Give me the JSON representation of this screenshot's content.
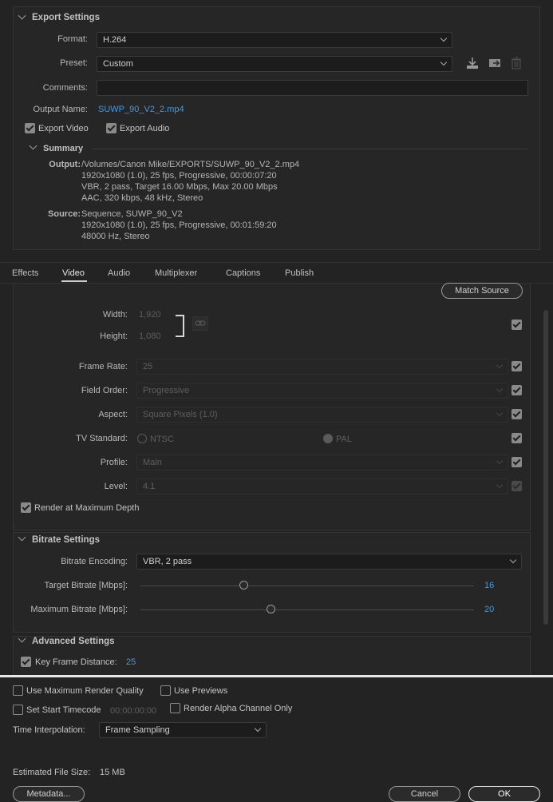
{
  "export_settings": {
    "header": "Export Settings",
    "format_label": "Format:",
    "format_value": "H.264",
    "preset_label": "Preset:",
    "preset_value": "Custom",
    "comments_label": "Comments:",
    "comments_value": "",
    "output_name_label": "Output Name:",
    "output_name_value": "SUWP_90_V2_2.mp4",
    "export_video_label": "Export Video",
    "export_video_checked": true,
    "export_audio_label": "Export Audio",
    "export_audio_checked": true
  },
  "summary": {
    "header": "Summary",
    "output_label": "Output:",
    "output_lines": [
      "/Volumes/Canon Mike/EXPORTS/SUWP_90_V2_2.mp4",
      "1920x1080 (1.0), 25 fps, Progressive, 00:00:07:20",
      "VBR, 2 pass, Target 16.00 Mbps, Max 20.00 Mbps",
      "AAC, 320 kbps, 48 kHz, Stereo"
    ],
    "source_label": "Source:",
    "source_lines": [
      "Sequence, SUWP_90_V2",
      "1920x1080 (1.0), 25 fps, Progressive, 00:01:59:20",
      "48000 Hz, Stereo"
    ]
  },
  "tabs": [
    "Effects",
    "Video",
    "Audio",
    "Multiplexer",
    "Captions",
    "Publish"
  ],
  "active_tab": "Video",
  "video": {
    "match_source_label": "Match Source",
    "width_label": "Width:",
    "width_value": "1,920",
    "height_label": "Height:",
    "height_value": "1,080",
    "frame_rate_label": "Frame Rate:",
    "frame_rate_value": "25",
    "field_order_label": "Field Order:",
    "field_order_value": "Progressive",
    "aspect_label": "Aspect:",
    "aspect_value": "Square Pixels (1.0)",
    "tv_standard_label": "TV Standard:",
    "ntsc_label": "NTSC",
    "pal_label": "PAL",
    "pal_selected": true,
    "profile_label": "Profile:",
    "profile_value": "Main",
    "level_label": "Level:",
    "level_value": "4.1",
    "render_max_depth_label": "Render at Maximum Depth",
    "render_max_depth_checked": true
  },
  "bitrate": {
    "header": "Bitrate Settings",
    "encoding_label": "Bitrate Encoding:",
    "encoding_value": "VBR, 2 pass",
    "target_label": "Target Bitrate [Mbps]:",
    "target_value": "16",
    "target_fraction": 0.31,
    "max_label": "Maximum Bitrate [Mbps]:",
    "max_value": "20",
    "max_fraction": 0.39
  },
  "advanced": {
    "header": "Advanced Settings",
    "key_frame_label": "Key Frame Distance:",
    "key_frame_value": "25",
    "key_frame_checked": true
  },
  "footer": {
    "max_render_quality_label": "Use Maximum Render Quality",
    "use_previews_label": "Use Previews",
    "set_start_timecode_label": "Set Start Timecode",
    "start_timecode_value": "00:00:00:00",
    "render_alpha_label": "Render Alpha Channel Only",
    "time_interp_label": "Time Interpolation:",
    "time_interp_value": "Frame Sampling",
    "est_size_label": "Estimated File Size:",
    "est_size_value": "15 MB",
    "metadata_label": "Metadata...",
    "cancel_label": "Cancel",
    "ok_label": "OK"
  },
  "colors": {
    "accent": "#3d9be9",
    "background": "#232323"
  }
}
